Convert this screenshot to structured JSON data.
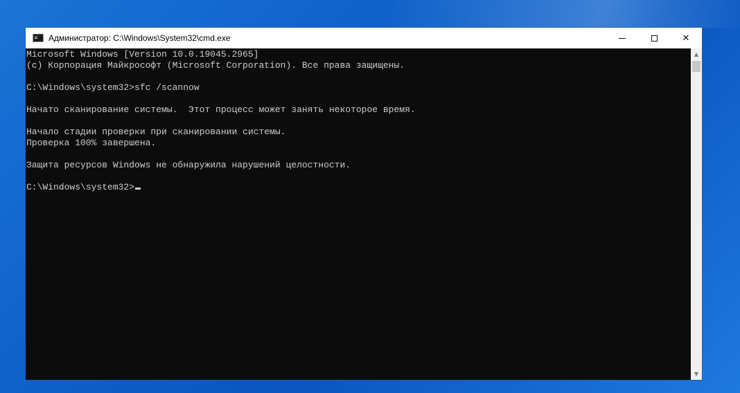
{
  "window": {
    "title": "Администратор: C:\\Windows\\System32\\cmd.exe",
    "icon": "cmd-icon",
    "controls": {
      "minimize": "minimize-icon",
      "maximize": "maximize-icon",
      "close_label": "✕"
    }
  },
  "console": {
    "lines": [
      "Microsoft Windows [Version 10.0.19045.2965]",
      "(c) Корпорация Майкрософт (Microsoft Corporation). Все права защищены.",
      "",
      "C:\\Windows\\system32>sfc /scannow",
      "",
      "Начато сканирование системы.  Этот процесс может занять некоторое время.",
      "",
      "Начало стадии проверки при сканировании системы.",
      "Проверка 100% завершена.",
      "",
      "Защита ресурсов Windows не обнаружила нарушений целостности.",
      ""
    ],
    "prompt": "C:\\Windows\\system32>"
  },
  "scrollbar": {
    "up_arrow": "▲",
    "down_arrow": "▼"
  },
  "colors": {
    "console_bg": "#0c0c0c",
    "console_text": "#cccccc",
    "titlebar_bg": "#ffffff",
    "desktop": "#0f61c9"
  }
}
